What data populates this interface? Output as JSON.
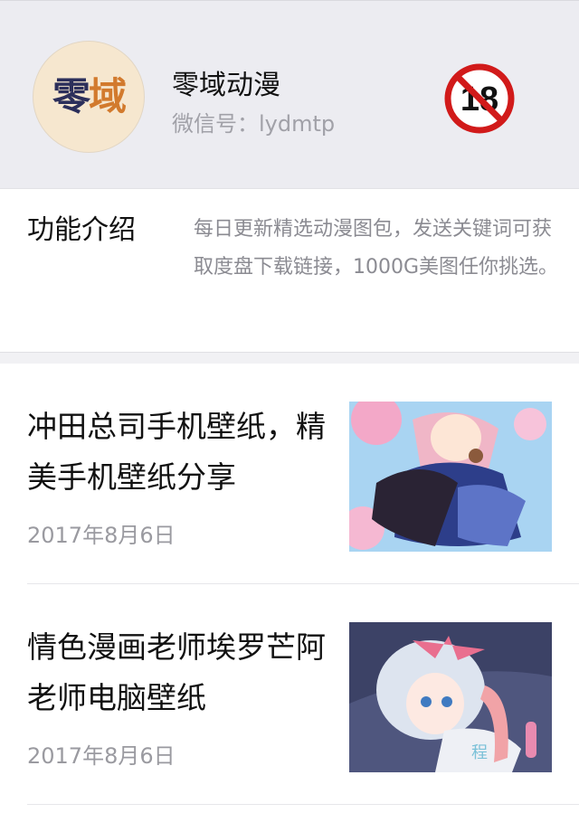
{
  "account": {
    "name": "零域动漫",
    "wechat_id": "微信号：lydmtp",
    "avatar_text_1": "零",
    "avatar_text_2": "域",
    "age_badge": "18"
  },
  "intro": {
    "label": "功能介绍",
    "description": "每日更新精选动漫图包，发送关键词可获取度盘下载链接，1000G美图任你挑选。"
  },
  "articles": [
    {
      "title": "冲田总司手机壁纸，精美手机壁纸分享",
      "date": "2017年8月6日"
    },
    {
      "title": "情色漫画老师埃罗芒阿老师电脑壁纸",
      "date": "2017年8月6日"
    }
  ],
  "colors": {
    "header_bg": "#ececf1",
    "badge_red": "#d11a1a",
    "muted_text": "#a1a1a8"
  }
}
